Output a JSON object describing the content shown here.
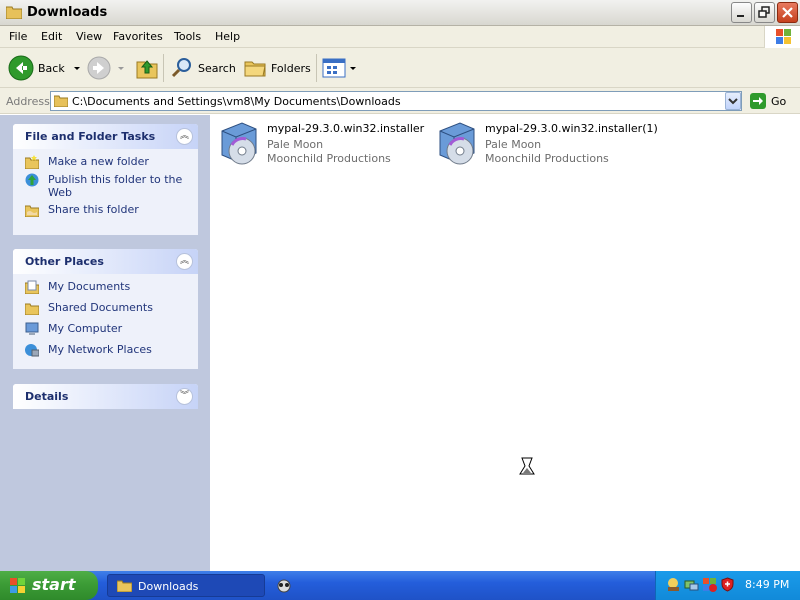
{
  "window": {
    "title": "Downloads"
  },
  "menu": {
    "items": [
      "File",
      "Edit",
      "View",
      "Favorites",
      "Tools",
      "Help"
    ]
  },
  "toolbar": {
    "back_label": "Back",
    "search_label": "Search",
    "folders_label": "Folders"
  },
  "address": {
    "label": "Address",
    "path": "C:\\Documents and Settings\\vm8\\My Documents\\Downloads",
    "go_label": "Go"
  },
  "sidebar": {
    "file_tasks": {
      "title": "File and Folder Tasks",
      "items": [
        {
          "label": "Make a new folder",
          "icon": "new-folder-icon"
        },
        {
          "label": "Publish this folder to the Web",
          "icon": "publish-web-icon"
        },
        {
          "label": "Share this folder",
          "icon": "share-folder-icon"
        }
      ]
    },
    "other_places": {
      "title": "Other Places",
      "items": [
        {
          "label": "My Documents",
          "icon": "my-documents-icon"
        },
        {
          "label": "Shared Documents",
          "icon": "shared-documents-icon"
        },
        {
          "label": "My Computer",
          "icon": "my-computer-icon"
        },
        {
          "label": "My Network Places",
          "icon": "network-places-icon"
        }
      ]
    },
    "details": {
      "title": "Details"
    }
  },
  "files": [
    {
      "name": "mypal-29.3.0.win32.installer",
      "line2": "Pale Moon",
      "line3": "Moonchild Productions",
      "icon": "installer-icon"
    },
    {
      "name": "mypal-29.3.0.win32.installer(1)",
      "line2": "Pale Moon",
      "line3": "Moonchild Productions",
      "icon": "installer-icon"
    }
  ],
  "taskbar": {
    "start_label": "start",
    "task_label": "Downloads",
    "clock": "8:49 PM"
  },
  "colors": {
    "taskbar_blue": "#245edb",
    "start_green": "#3c9c36",
    "sidebar_bg": "#bfc8de",
    "task_link": "#21357a"
  }
}
